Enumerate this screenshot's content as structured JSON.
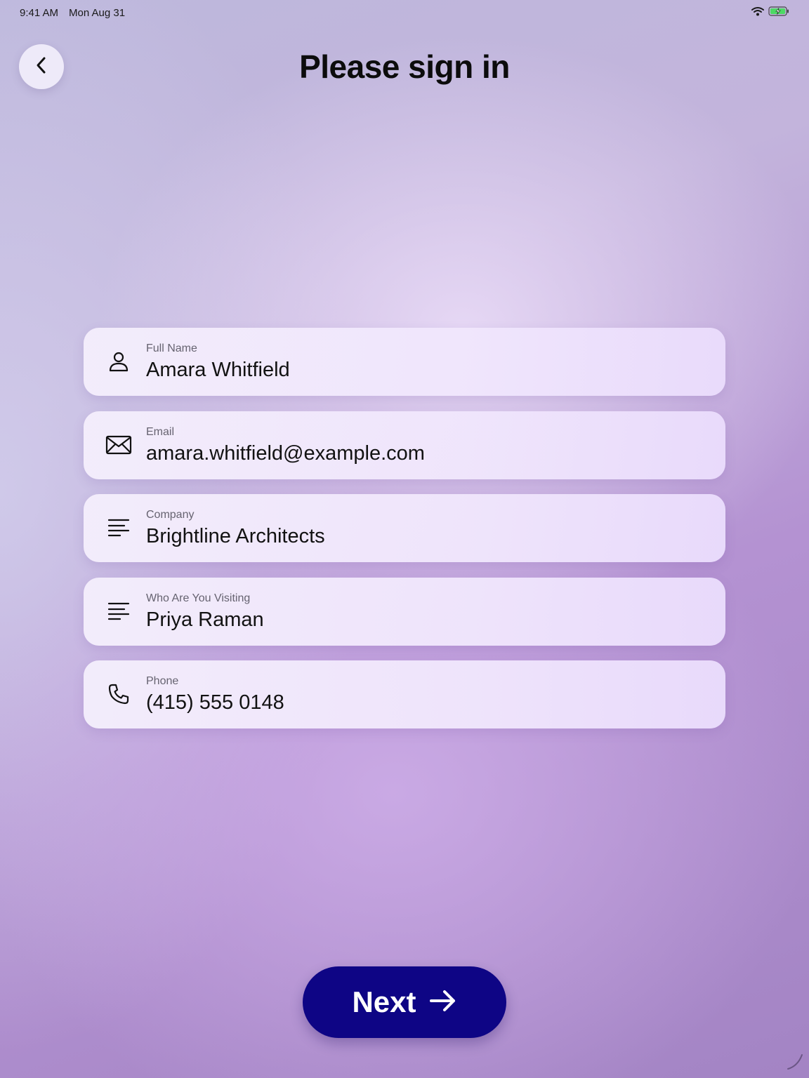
{
  "status_bar": {
    "time": "9:41 AM",
    "date": "Mon Aug 31",
    "icons": [
      "wifi-icon",
      "battery-charging-icon"
    ],
    "battery_color": "#4cd964"
  },
  "header": {
    "back_icon": "chevron-left-icon",
    "title": "Please sign in"
  },
  "form": {
    "fields": [
      {
        "label": "Full Name",
        "value": "Amara Whitfield",
        "icon": "person-icon"
      },
      {
        "label": "Email",
        "value": "amara.whitfield@example.com",
        "icon": "envelope-icon"
      },
      {
        "label": "Company",
        "value": "Brightline Architects",
        "icon": "text-lines-icon"
      },
      {
        "label": "Who Are You Visiting",
        "value": "Priya Raman",
        "icon": "text-lines-icon"
      },
      {
        "label": "Phone",
        "value": "(415) 555 0148",
        "icon": "phone-icon"
      }
    ]
  },
  "footer": {
    "next_label": "Next",
    "next_icon": "arrow-right-icon",
    "button_color": "#0e0585"
  }
}
